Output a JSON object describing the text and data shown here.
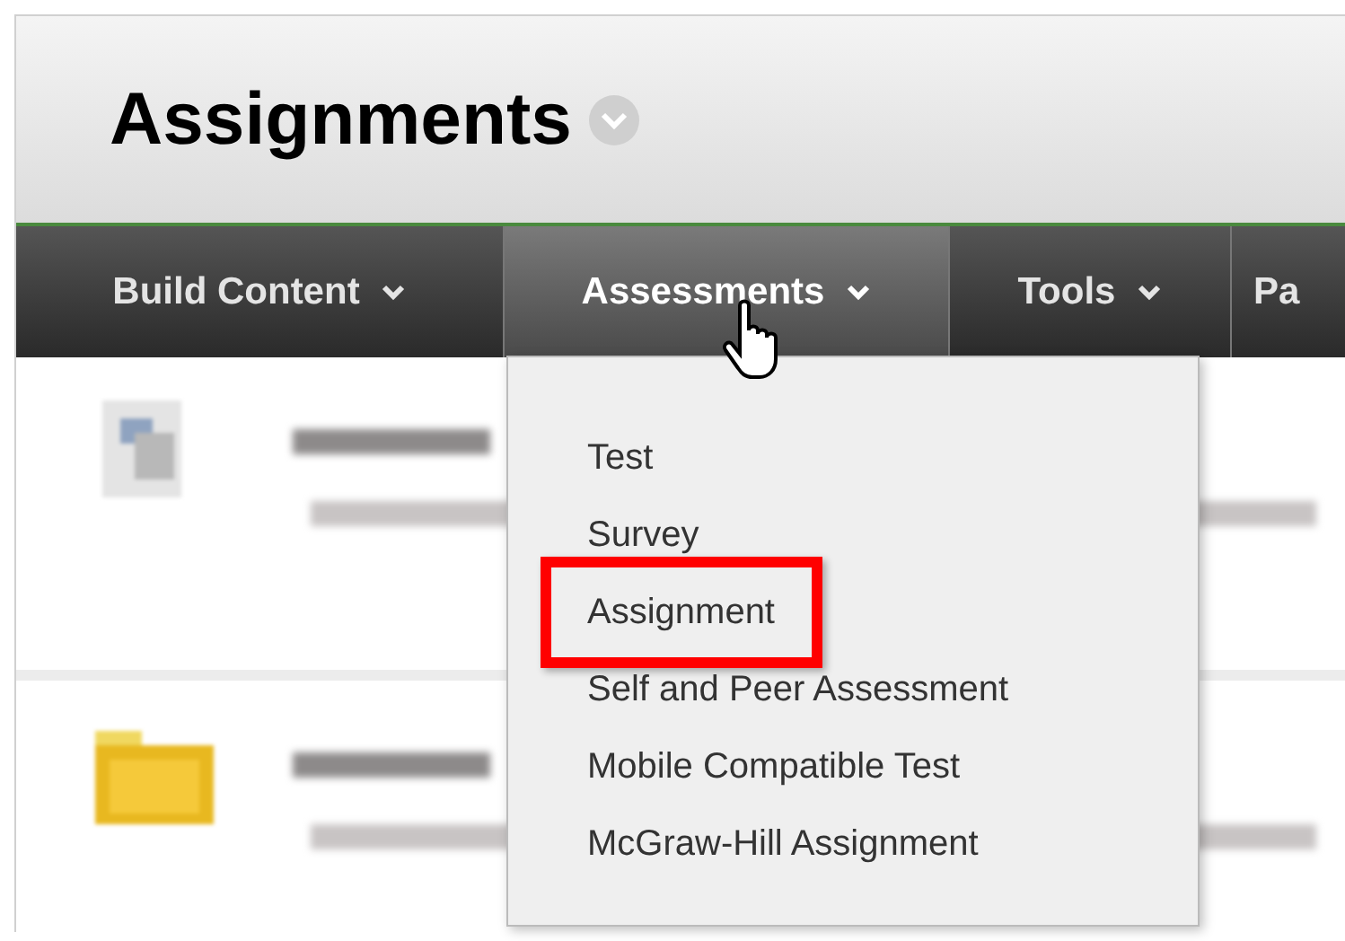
{
  "page": {
    "title": "Assignments"
  },
  "nav_tabs": [
    {
      "label": "Build Content",
      "selected": false,
      "has_caret": true
    },
    {
      "label": "Assessments",
      "selected": true,
      "has_caret": true
    },
    {
      "label": "Tools",
      "selected": false,
      "has_caret": true
    },
    {
      "label": "Pa",
      "selected": false,
      "has_caret": false
    }
  ],
  "menu": {
    "items": [
      {
        "label": "Test",
        "highlighted": false
      },
      {
        "label": "Survey",
        "highlighted": false
      },
      {
        "label": "Assignment",
        "highlighted": true
      },
      {
        "label": "Self and Peer Assessment",
        "highlighted": false
      },
      {
        "label": "Mobile Compatible Test",
        "highlighted": false
      },
      {
        "label": "McGraw-Hill Assignment",
        "highlighted": false
      }
    ]
  },
  "content_items": [
    {
      "kind": "document"
    },
    {
      "kind": "folder"
    }
  ]
}
